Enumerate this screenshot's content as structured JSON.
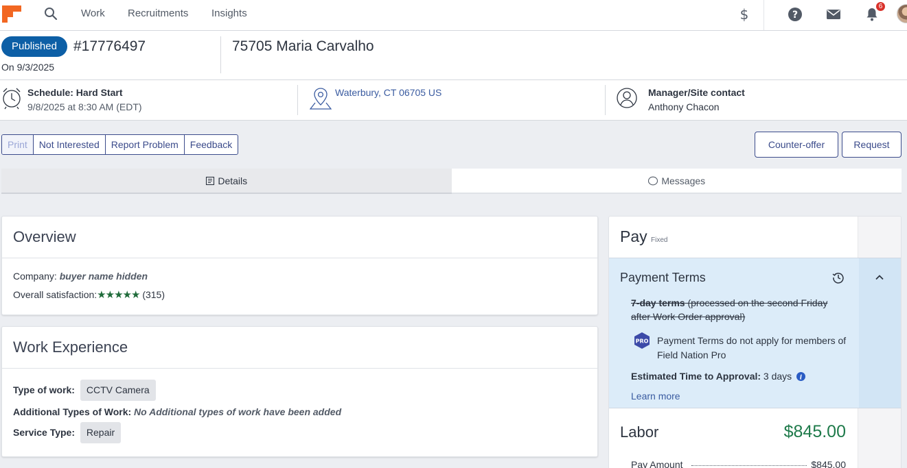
{
  "nav": {
    "links": [
      "Work",
      "Recruitments",
      "Insights"
    ],
    "notification_count": "6"
  },
  "header": {
    "status": "Published",
    "work_order_id": "#17776497",
    "published_date": "On 9/3/2025",
    "title": "75705 Maria Carvalho"
  },
  "info": {
    "schedule_title": "Schedule: Hard Start",
    "schedule_time": "9/8/2025 at 8:30 AM (EDT)",
    "location": "Waterbury, CT 06705 US",
    "contact_title": "Manager/Site contact",
    "contact_name": "Anthony Chacon"
  },
  "actions": {
    "group": [
      "Print",
      "Not Interested",
      "Report Problem",
      "Feedback"
    ],
    "counter_offer": "Counter-offer",
    "request": "Request"
  },
  "tabs": {
    "details": "Details",
    "messages": "Messages"
  },
  "overview": {
    "title": "Overview",
    "company_label": "Company:",
    "company_value": "buyer name hidden",
    "satisfaction_label": "Overall satisfaction:",
    "stars": "★★★★★",
    "rating_count": "(315)"
  },
  "experience": {
    "title": "Work Experience",
    "type_label": "Type of work:",
    "type_value": "CCTV Camera",
    "additional_label": "Additional Types of Work:",
    "additional_value": "No Additional types of work have been added",
    "service_label": "Service Type:",
    "service_value": "Repair"
  },
  "pay": {
    "title": "Pay",
    "kind": "Fixed",
    "terms_title": "Payment Terms",
    "terms_bold": "7-day terms",
    "terms_rest": " (processed on the second Friday after Work Order approval)",
    "pro_badge": "PRO",
    "pro_text": "Payment Terms do not apply for members of Field Nation Pro",
    "eta_label": "Estimated Time to Approval:",
    "eta_value": " 3 days",
    "learn_more": "Learn more",
    "labor_label": "Labor",
    "labor_value": "$845.00",
    "pay_amount_label": "Pay Amount",
    "pay_amount_value": "$845.00"
  },
  "colors": {
    "brand_orange": "#f26722",
    "published_blue": "#0d5fa6",
    "labor_green": "#1e7a4a",
    "terms_bg": "#dcecf9"
  },
  "icons": [
    "logo-icon",
    "search-icon",
    "dollar-icon",
    "help-icon",
    "mail-icon",
    "bell-icon",
    "alarm-clock-icon",
    "map-pin-icon",
    "person-icon",
    "details-icon",
    "message-icon",
    "history-icon",
    "chevron-up-icon",
    "pro-badge-icon",
    "info-icon"
  ]
}
